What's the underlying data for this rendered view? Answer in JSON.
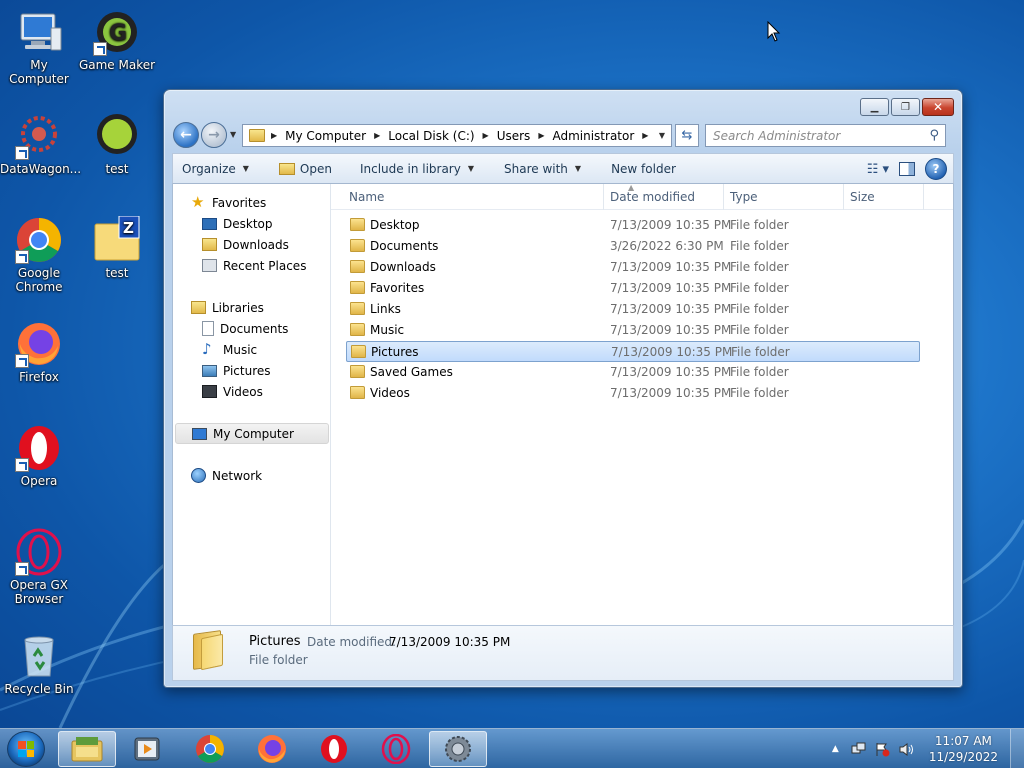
{
  "desktop": {
    "icons": [
      {
        "label": "My Computer",
        "icon": "computer-icon"
      },
      {
        "label": "Game Maker",
        "icon": "gamemaker-icon"
      },
      {
        "label": "DataWagon...",
        "icon": "datawagon-icon"
      },
      {
        "label": "test",
        "icon": "gamemaker-green-icon"
      },
      {
        "label": "Google Chrome",
        "icon": "chrome-icon"
      },
      {
        "label": "test",
        "icon": "zip-folder-icon"
      },
      {
        "label": "Firefox",
        "icon": "firefox-icon"
      },
      {
        "label": "Opera",
        "icon": "opera-icon"
      },
      {
        "label": "Opera GX Browser",
        "icon": "opera-gx-icon"
      },
      {
        "label": "Recycle Bin",
        "icon": "recycle-bin-icon"
      }
    ]
  },
  "explorer": {
    "breadcrumb": [
      "My Computer",
      "Local Disk (C:)",
      "Users",
      "Administrator"
    ],
    "search_placeholder": "Search Administrator",
    "toolbar": {
      "organize": "Organize",
      "open": "Open",
      "include_in_library": "Include in library",
      "share_with": "Share with",
      "new_folder": "New folder"
    },
    "nav_pane": {
      "favorites": "Favorites",
      "favorites_items": [
        "Desktop",
        "Downloads",
        "Recent Places"
      ],
      "libraries": "Libraries",
      "libraries_items": [
        "Documents",
        "Music",
        "Pictures",
        "Videos"
      ],
      "my_computer": "My Computer",
      "network": "Network"
    },
    "columns": {
      "name": "Name",
      "date_modified": "Date modified",
      "type": "Type",
      "size": "Size"
    },
    "files": [
      {
        "name": "Desktop",
        "date": "7/13/2009 10:35 PM",
        "type": "File folder"
      },
      {
        "name": "Documents",
        "date": "3/26/2022 6:30 PM",
        "type": "File folder"
      },
      {
        "name": "Downloads",
        "date": "7/13/2009 10:35 PM",
        "type": "File folder"
      },
      {
        "name": "Favorites",
        "date": "7/13/2009 10:35 PM",
        "type": "File folder"
      },
      {
        "name": "Links",
        "date": "7/13/2009 10:35 PM",
        "type": "File folder"
      },
      {
        "name": "Music",
        "date": "7/13/2009 10:35 PM",
        "type": "File folder"
      },
      {
        "name": "Pictures",
        "date": "7/13/2009 10:35 PM",
        "type": "File folder",
        "selected": true
      },
      {
        "name": "Saved Games",
        "date": "7/13/2009 10:35 PM",
        "type": "File folder"
      },
      {
        "name": "Videos",
        "date": "7/13/2009 10:35 PM",
        "type": "File folder"
      }
    ],
    "details": {
      "name": "Pictures",
      "date_label": "Date modified:",
      "date_value": "7/13/2009 10:35 PM",
      "type": "File folder"
    }
  },
  "taskbar": {
    "pinned": [
      "libraries-icon",
      "media-player-icon",
      "chrome-icon",
      "firefox-icon",
      "opera-icon",
      "opera-gx-icon",
      "gamemaker-icon"
    ],
    "time": "11:07 AM",
    "date": "11/29/2022"
  },
  "colors": {
    "desktop_bg": "#1d74c9",
    "selection": "#c1dbfc",
    "window_frame": "#b9d1ec"
  }
}
